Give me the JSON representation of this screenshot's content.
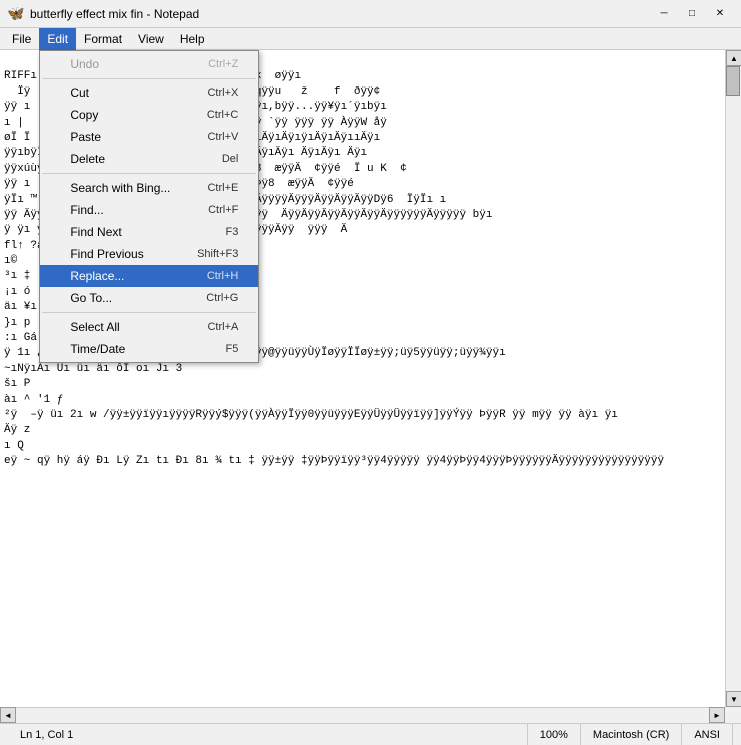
{
  "titleBar": {
    "icon": "🦋",
    "title": "butterfly effect mix fin - Notepad",
    "minimize": "─",
    "maximize": "□",
    "close": "✕"
  },
  "menuBar": {
    "items": [
      "File",
      "Edit",
      "Format",
      "View",
      "Help"
    ]
  },
  "editMenu": {
    "items": [
      {
        "label": "Undo",
        "shortcut": "Ctrl+Z",
        "disabled": true
      },
      {
        "label": "separator"
      },
      {
        "label": "Cut",
        "shortcut": "Ctrl+X"
      },
      {
        "label": "Copy",
        "shortcut": "Ctrl+C"
      },
      {
        "label": "Paste",
        "shortcut": "Ctrl+V"
      },
      {
        "label": "Delete",
        "shortcut": "Del"
      },
      {
        "label": "separator"
      },
      {
        "label": "Search with Bing...",
        "shortcut": "Ctrl+E"
      },
      {
        "label": "Find...",
        "shortcut": "Ctrl+F"
      },
      {
        "label": "Find Next",
        "shortcut": "F3"
      },
      {
        "label": "Find Previous",
        "shortcut": "Shift+F3"
      },
      {
        "label": "Replace...",
        "shortcut": "Ctrl+H",
        "highlighted": true
      },
      {
        "label": "Go To...",
        "shortcut": "Ctrl+G"
      },
      {
        "label": "separator"
      },
      {
        "label": "Select All",
        "shortcut": "Ctrl+A"
      },
      {
        "label": "Time/Date",
        "shortcut": "F5"
      }
    ]
  },
  "statusBar": {
    "position": "Ln 1, Col 1",
    "zoom": "100%",
    "lineEnding": "Macintosh (CR)",
    "encoding": "ANSI"
  },
  "content": "RIFFı   fmt ı  €»  eı ı data°ı8 æÿÿêÿÿx  øÿÿı\n  Ïÿ  ÃÿÿÏı  mÿÿ4ÿÿøÿÿ1ÿÿ. C  aÿÿcÿÿÏ qÿÿu   ž    f  ðÿÿ¢\nÿÿ ı  ´ÿı¿ÿıÙÿıýÿıáÿıÙÿı¸ÿÿ,bÿıbÿıTÿıÀÿı,bÿÿ...ÿÿ¥ÿı´ÿıbÿı\nı |   ; „ÿ ¸ Ïı Àÿÿ Ïÿı AÿÿıÀÿı`ÿÿ  -ÿÿ `ÿÿ ÿÿÿ ÿÿ ÀÿÿW åÿ\nøÏ Ï  ı  eÿıÄÿıïÿıèÿıÄÿııÿıÄÿıÄÿıÄÿıÄÿıÄÿıÄÿıÿıÄÿıÄÿııÄÿı\nÿÿıbÿÏı bÿıÄÿıóÿı ÿÿøı ıeÿıïÿı ÄÿıÄÿı ÄÿıÄÿı ÄÿıÄÿı Äÿı\nÿÿxúùÿøÿı ıý|ùüÿóÿ ı !ÿÿ -ÿÿÿ  xÿÿ ZÞÿ8  æÿÿÄ  ¢ÿÿé  Ï u K  ¢\nÿÿ ı  «ÿÿ  ı  *ıÿÿÄÿı  àÿÿýÿÿ ÿÿÿ ÿÿ ZÞÿ8  æÿÿÄ  ¢ÿÿé\nÿÏı ™ ÀÿÿÄ« «ÿÿÏÿÿÚÿÿ ÿÿÿÿÿ ÄÿÿÿÄÿÿÄÿÿÄÿÿÿÿÄÿÿÿÄÿÿÄÿÿÄÿÿDÿ6  ÏÿÏı ı\nÿÿ ÄÿÿÄÿÿÄÿÿ ı4ÿÿÄÿÿ ÄÿÿÿÿÿÄÿÿ ı ÄÿÿÿÄÿÿ  ÄÿÿÄÿÿÄÿÿÄÿÿÄÿÿÄÿÿÿÿÿÿÄÿÿÿÿÿ bÿı\nÿ ÿı ÿÿı ÿÿı  ÄÿÿÄÿÿÄÿÿÿ ÿÿÿ  Äÿÿ Äÿÿ ÿÿÿÄÿÿ  ÿÿÿ  Ä"
}
